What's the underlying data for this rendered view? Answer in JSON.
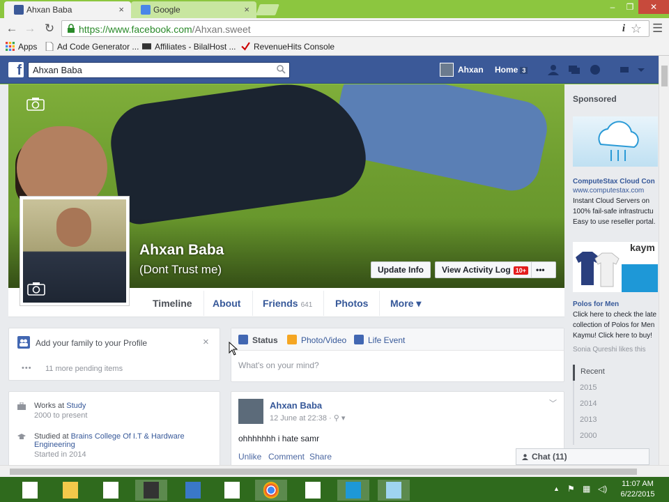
{
  "browser": {
    "tabs": [
      {
        "title": "Ahxan Baba",
        "close": "×"
      },
      {
        "title": "Google",
        "close": "×"
      }
    ],
    "window_controls": {
      "minimize": "–",
      "maximize": "❐",
      "close": "✕"
    },
    "url_scheme": "https://",
    "url_host": "www.facebook.com",
    "url_path": "/Ahxan.sweet",
    "bookmarks": [
      {
        "label": "Apps"
      },
      {
        "label": "Ad Code Generator ..."
      },
      {
        "label": "Affiliates - BilalHost ..."
      },
      {
        "label": "RevenueHits Console"
      }
    ]
  },
  "facebook": {
    "logo": "f",
    "search_value": "Ahxan Baba",
    "user_name": "Ahxan",
    "home_label": "Home",
    "home_count": "3"
  },
  "profile": {
    "name": "Ahxan Baba",
    "nickname": "(Dont Trust me)",
    "update_info": "Update Info",
    "activity_log": "View Activity Log",
    "activity_badge": "10+",
    "more_dots": "•••",
    "tabs": [
      {
        "label": "Timeline"
      },
      {
        "label": "About"
      },
      {
        "label": "Friends",
        "count": "641"
      },
      {
        "label": "Photos"
      },
      {
        "label": "More ▾"
      }
    ]
  },
  "family": {
    "title": "Add your family to your Profile",
    "close": "×",
    "dots": "•••",
    "pending": "11 more pending items"
  },
  "composer": {
    "status": "Status",
    "photo_video": "Photo/Video",
    "life_event": "Life Event",
    "placeholder": "What's on your mind?"
  },
  "intro": {
    "work_prefix": "Works at",
    "work_place": "Study",
    "work_sub": "2000 to present",
    "study_prefix": "Studied at",
    "study_place": "Brains College Of I.T & Hardware Engineering",
    "study_sub": "Started in 2014"
  },
  "post": {
    "author": "Ahxan Baba",
    "time": "12 June at 22:38 · ⚲ ▾",
    "text": "ohhhhhhh i hate samr",
    "unlike": "Unlike",
    "comment": "Comment",
    "share": "Share",
    "chevron": "﹀"
  },
  "sidebar": {
    "sponsored": "Sponsored",
    "ads": [
      {
        "title": "ComputeStax Cloud Con",
        "url": "www.computestax.com",
        "text": "Instant Cloud Servers on 100% fail-safe infrastructu Easy to use reseller portal."
      },
      {
        "title": "Polos for Men",
        "text": "Click here to check the late collection of Polos for Men Kaymu! Click here to buy!",
        "like": "Sonia Qureshi likes this"
      }
    ],
    "ad_brand": "kaym",
    "years": [
      "Recent",
      "2015",
      "2014",
      "2013",
      "2000"
    ]
  },
  "chat": {
    "label": "Chat (11)"
  },
  "taskbar": {
    "time": "11:07 AM",
    "date": "6/22/2015",
    "tray_up": "▲"
  },
  "colors": {
    "fb_blue": "#3b5998",
    "link": "#365899",
    "chrome_green": "#8cc63f",
    "taskbar": "#2f6a1d"
  }
}
